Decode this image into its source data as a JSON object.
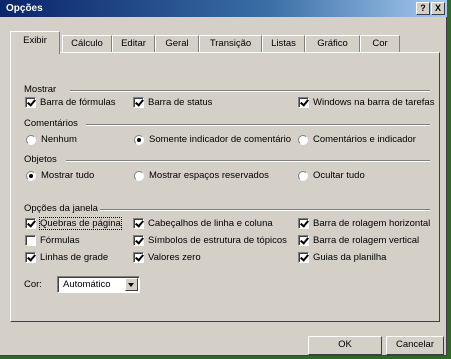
{
  "window": {
    "title": "Opções",
    "help_btn": "?",
    "close_btn": "X"
  },
  "tabs": [
    "Exibir",
    "Cálculo",
    "Editar",
    "Geral",
    "Transição",
    "Listas",
    "Gráfico",
    "Cor"
  ],
  "mostrar": {
    "label": "Mostrar",
    "options": [
      {
        "label": "Barra de fórmulas",
        "checked": true
      },
      {
        "label": "Barra de status",
        "checked": true
      },
      {
        "label": "Windows na barra de tarefas",
        "checked": true
      }
    ]
  },
  "comentarios": {
    "label": "Comentários",
    "options": [
      {
        "label": "Nenhum",
        "selected": false
      },
      {
        "label": "Somente indicador de comentário",
        "selected": true
      },
      {
        "label": "Comentários e indicador",
        "selected": false
      }
    ]
  },
  "objetos": {
    "label": "Objetos",
    "options": [
      {
        "label": "Mostrar tudo",
        "selected": true
      },
      {
        "label": "Mostrar espaços reservados",
        "selected": false
      },
      {
        "label": "Ocultar tudo",
        "selected": false
      }
    ]
  },
  "janela": {
    "label": "Opções da janela",
    "options": [
      {
        "label": "Quebras de página",
        "checked": true
      },
      {
        "label": "Cabeçalhos de linha e coluna",
        "checked": true
      },
      {
        "label": "Barra de rolagem horizontal",
        "checked": true
      },
      {
        "label": "Fórmulas",
        "checked": false
      },
      {
        "label": "Símbolos de estrutura de tópicos",
        "checked": true
      },
      {
        "label": "Barra de rolagem vertical",
        "checked": true
      },
      {
        "label": "Linhas de grade",
        "checked": true
      },
      {
        "label": "Valores zero",
        "checked": true
      },
      {
        "label": "Guias da planilha",
        "checked": true
      }
    ],
    "cor_label": "Cor:",
    "cor_value": "Automático"
  },
  "buttons": {
    "ok": "OK",
    "cancel": "Cancelar"
  }
}
